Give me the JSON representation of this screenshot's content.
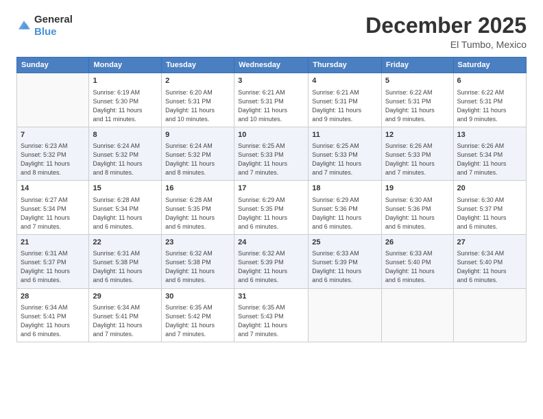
{
  "logo": {
    "general": "General",
    "blue": "Blue"
  },
  "title": "December 2025",
  "location": "El Tumbo, Mexico",
  "days_header": [
    "Sunday",
    "Monday",
    "Tuesday",
    "Wednesday",
    "Thursday",
    "Friday",
    "Saturday"
  ],
  "weeks": [
    [
      {
        "day": "",
        "sunrise": "",
        "sunset": "",
        "daylight": ""
      },
      {
        "day": "1",
        "sunrise": "Sunrise: 6:19 AM",
        "sunset": "Sunset: 5:30 PM",
        "daylight": "Daylight: 11 hours and 11 minutes."
      },
      {
        "day": "2",
        "sunrise": "Sunrise: 6:20 AM",
        "sunset": "Sunset: 5:31 PM",
        "daylight": "Daylight: 11 hours and 10 minutes."
      },
      {
        "day": "3",
        "sunrise": "Sunrise: 6:21 AM",
        "sunset": "Sunset: 5:31 PM",
        "daylight": "Daylight: 11 hours and 10 minutes."
      },
      {
        "day": "4",
        "sunrise": "Sunrise: 6:21 AM",
        "sunset": "Sunset: 5:31 PM",
        "daylight": "Daylight: 11 hours and 9 minutes."
      },
      {
        "day": "5",
        "sunrise": "Sunrise: 6:22 AM",
        "sunset": "Sunset: 5:31 PM",
        "daylight": "Daylight: 11 hours and 9 minutes."
      },
      {
        "day": "6",
        "sunrise": "Sunrise: 6:22 AM",
        "sunset": "Sunset: 5:31 PM",
        "daylight": "Daylight: 11 hours and 9 minutes."
      }
    ],
    [
      {
        "day": "7",
        "sunrise": "Sunrise: 6:23 AM",
        "sunset": "Sunset: 5:32 PM",
        "daylight": "Daylight: 11 hours and 8 minutes."
      },
      {
        "day": "8",
        "sunrise": "Sunrise: 6:24 AM",
        "sunset": "Sunset: 5:32 PM",
        "daylight": "Daylight: 11 hours and 8 minutes."
      },
      {
        "day": "9",
        "sunrise": "Sunrise: 6:24 AM",
        "sunset": "Sunset: 5:32 PM",
        "daylight": "Daylight: 11 hours and 8 minutes."
      },
      {
        "day": "10",
        "sunrise": "Sunrise: 6:25 AM",
        "sunset": "Sunset: 5:33 PM",
        "daylight": "Daylight: 11 hours and 7 minutes."
      },
      {
        "day": "11",
        "sunrise": "Sunrise: 6:25 AM",
        "sunset": "Sunset: 5:33 PM",
        "daylight": "Daylight: 11 hours and 7 minutes."
      },
      {
        "day": "12",
        "sunrise": "Sunrise: 6:26 AM",
        "sunset": "Sunset: 5:33 PM",
        "daylight": "Daylight: 11 hours and 7 minutes."
      },
      {
        "day": "13",
        "sunrise": "Sunrise: 6:26 AM",
        "sunset": "Sunset: 5:34 PM",
        "daylight": "Daylight: 11 hours and 7 minutes."
      }
    ],
    [
      {
        "day": "14",
        "sunrise": "Sunrise: 6:27 AM",
        "sunset": "Sunset: 5:34 PM",
        "daylight": "Daylight: 11 hours and 7 minutes."
      },
      {
        "day": "15",
        "sunrise": "Sunrise: 6:28 AM",
        "sunset": "Sunset: 5:34 PM",
        "daylight": "Daylight: 11 hours and 6 minutes."
      },
      {
        "day": "16",
        "sunrise": "Sunrise: 6:28 AM",
        "sunset": "Sunset: 5:35 PM",
        "daylight": "Daylight: 11 hours and 6 minutes."
      },
      {
        "day": "17",
        "sunrise": "Sunrise: 6:29 AM",
        "sunset": "Sunset: 5:35 PM",
        "daylight": "Daylight: 11 hours and 6 minutes."
      },
      {
        "day": "18",
        "sunrise": "Sunrise: 6:29 AM",
        "sunset": "Sunset: 5:36 PM",
        "daylight": "Daylight: 11 hours and 6 minutes."
      },
      {
        "day": "19",
        "sunrise": "Sunrise: 6:30 AM",
        "sunset": "Sunset: 5:36 PM",
        "daylight": "Daylight: 11 hours and 6 minutes."
      },
      {
        "day": "20",
        "sunrise": "Sunrise: 6:30 AM",
        "sunset": "Sunset: 5:37 PM",
        "daylight": "Daylight: 11 hours and 6 minutes."
      }
    ],
    [
      {
        "day": "21",
        "sunrise": "Sunrise: 6:31 AM",
        "sunset": "Sunset: 5:37 PM",
        "daylight": "Daylight: 11 hours and 6 minutes."
      },
      {
        "day": "22",
        "sunrise": "Sunrise: 6:31 AM",
        "sunset": "Sunset: 5:38 PM",
        "daylight": "Daylight: 11 hours and 6 minutes."
      },
      {
        "day": "23",
        "sunrise": "Sunrise: 6:32 AM",
        "sunset": "Sunset: 5:38 PM",
        "daylight": "Daylight: 11 hours and 6 minutes."
      },
      {
        "day": "24",
        "sunrise": "Sunrise: 6:32 AM",
        "sunset": "Sunset: 5:39 PM",
        "daylight": "Daylight: 11 hours and 6 minutes."
      },
      {
        "day": "25",
        "sunrise": "Sunrise: 6:33 AM",
        "sunset": "Sunset: 5:39 PM",
        "daylight": "Daylight: 11 hours and 6 minutes."
      },
      {
        "day": "26",
        "sunrise": "Sunrise: 6:33 AM",
        "sunset": "Sunset: 5:40 PM",
        "daylight": "Daylight: 11 hours and 6 minutes."
      },
      {
        "day": "27",
        "sunrise": "Sunrise: 6:34 AM",
        "sunset": "Sunset: 5:40 PM",
        "daylight": "Daylight: 11 hours and 6 minutes."
      }
    ],
    [
      {
        "day": "28",
        "sunrise": "Sunrise: 6:34 AM",
        "sunset": "Sunset: 5:41 PM",
        "daylight": "Daylight: 11 hours and 6 minutes."
      },
      {
        "day": "29",
        "sunrise": "Sunrise: 6:34 AM",
        "sunset": "Sunset: 5:41 PM",
        "daylight": "Daylight: 11 hours and 7 minutes."
      },
      {
        "day": "30",
        "sunrise": "Sunrise: 6:35 AM",
        "sunset": "Sunset: 5:42 PM",
        "daylight": "Daylight: 11 hours and 7 minutes."
      },
      {
        "day": "31",
        "sunrise": "Sunrise: 6:35 AM",
        "sunset": "Sunset: 5:43 PM",
        "daylight": "Daylight: 11 hours and 7 minutes."
      },
      {
        "day": "",
        "sunrise": "",
        "sunset": "",
        "daylight": ""
      },
      {
        "day": "",
        "sunrise": "",
        "sunset": "",
        "daylight": ""
      },
      {
        "day": "",
        "sunrise": "",
        "sunset": "",
        "daylight": ""
      }
    ]
  ]
}
